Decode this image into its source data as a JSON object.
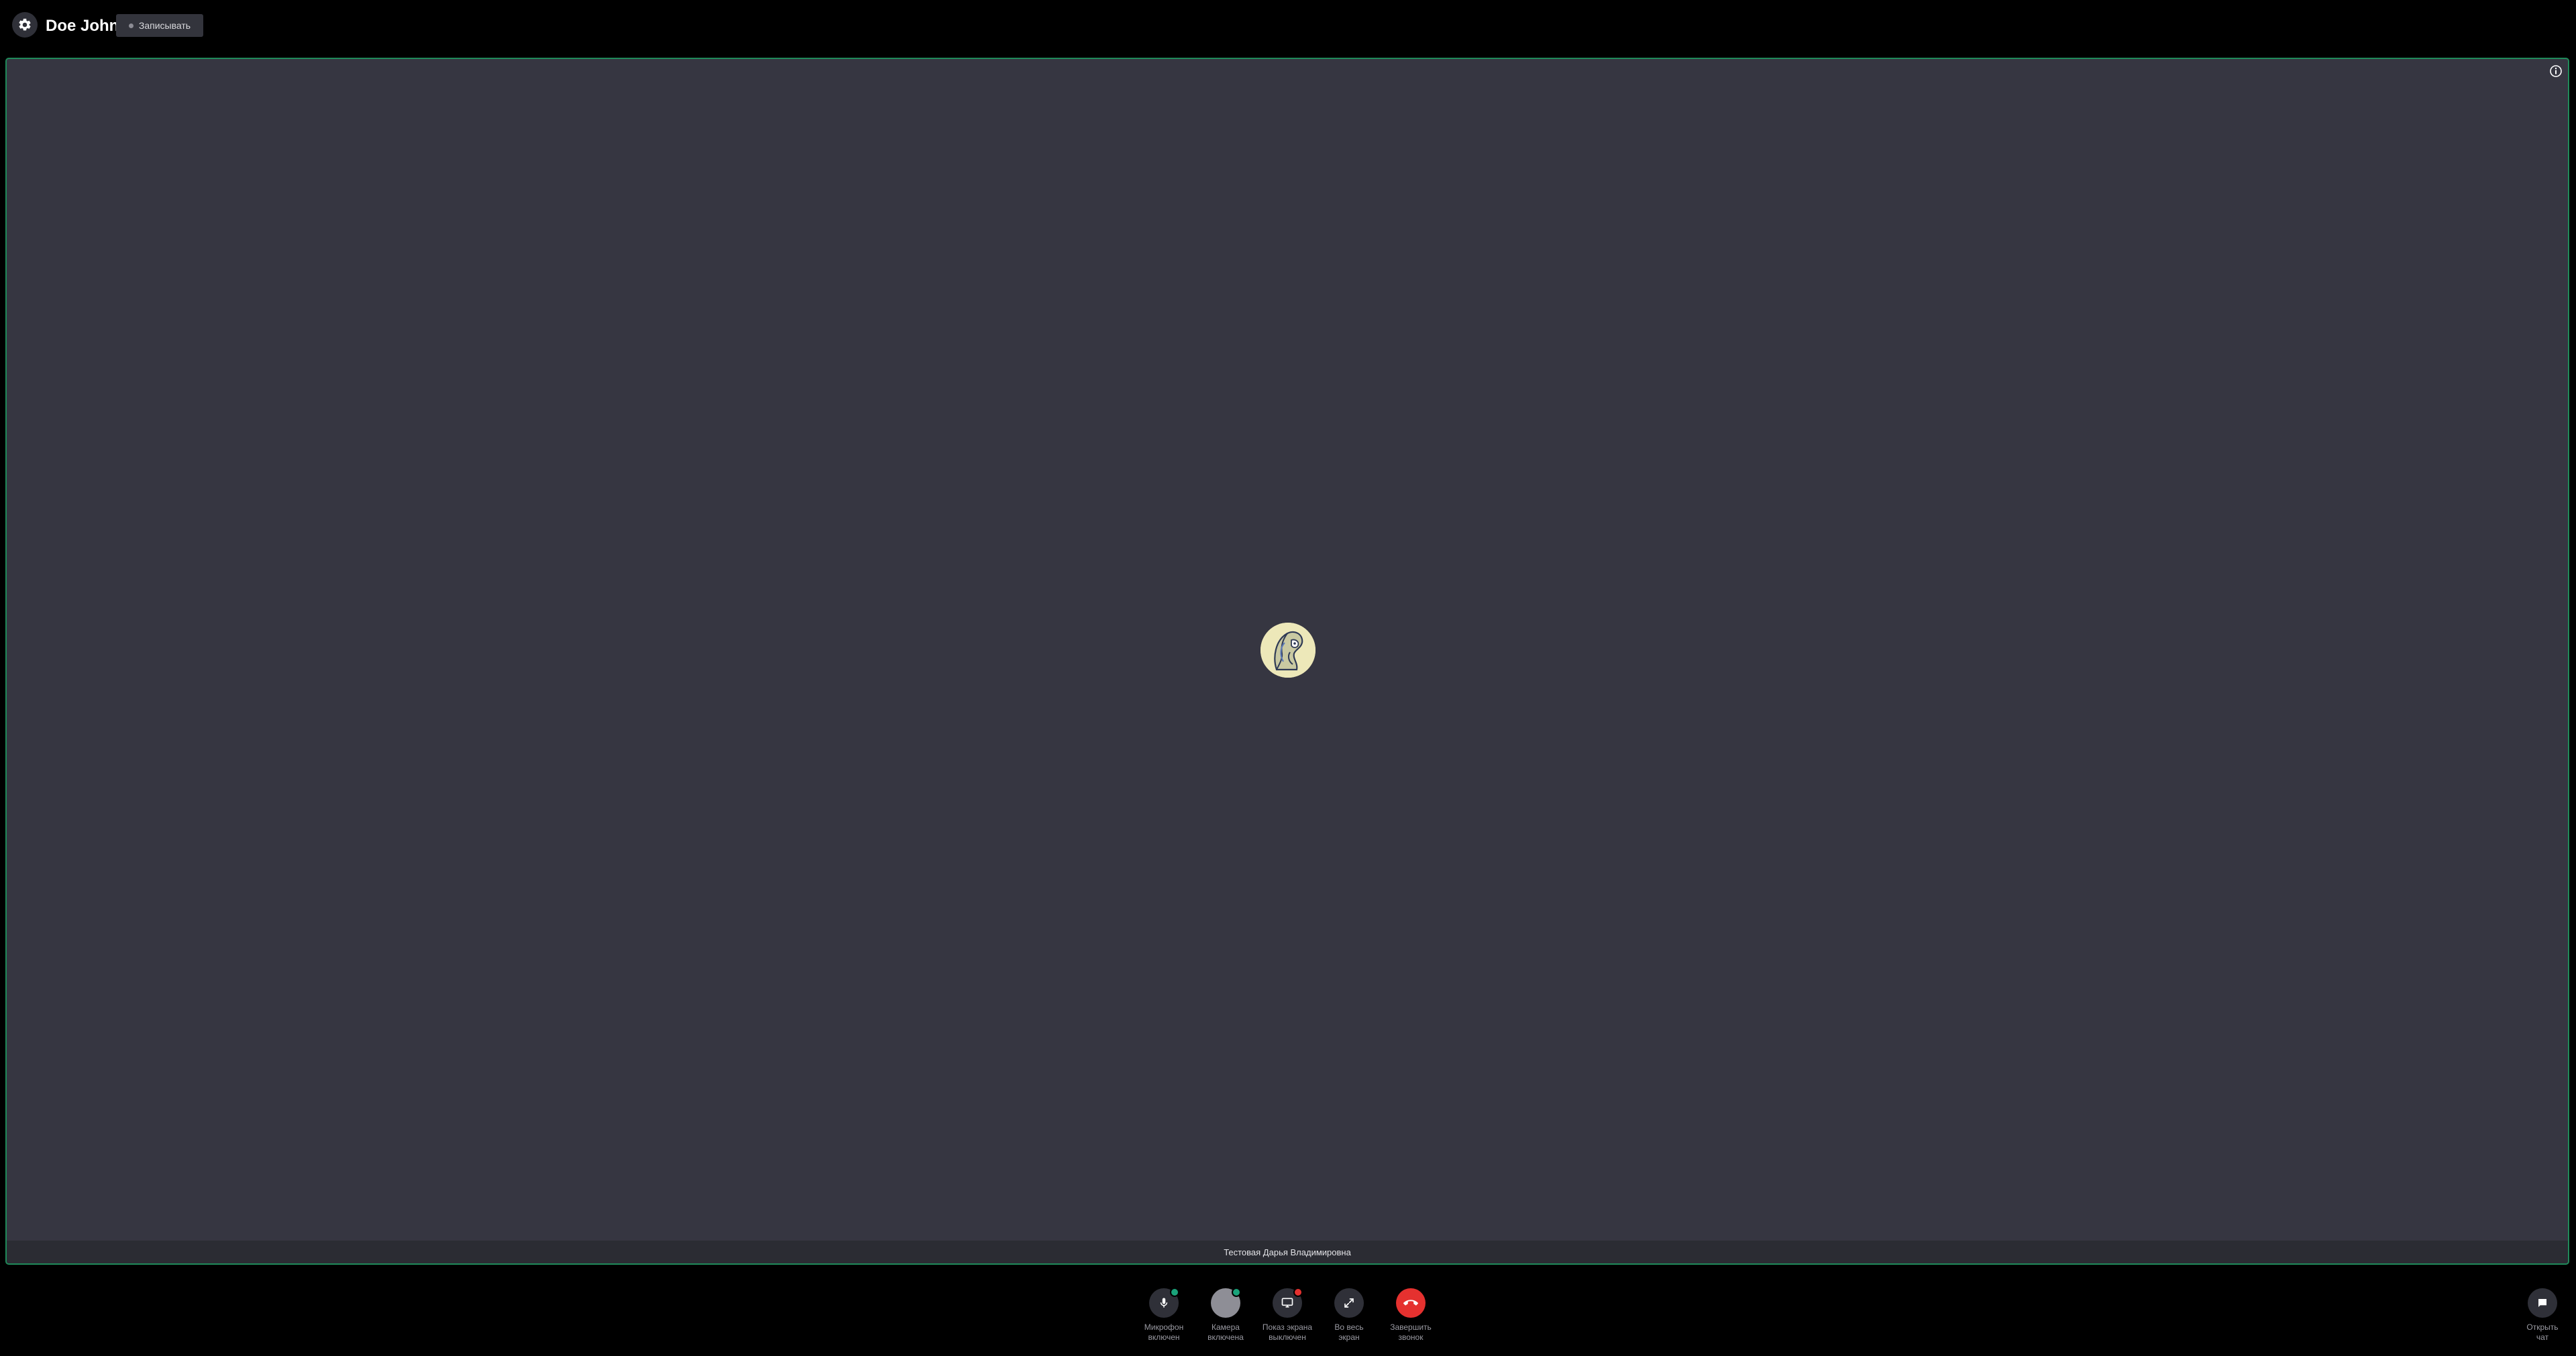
{
  "header": {
    "title": "Doe John",
    "record_label": "Записывать",
    "settings_icon": "gear-icon"
  },
  "stage": {
    "participant_name": "Тестовая Дарья Владимировна",
    "info_icon": "info-icon",
    "avatar_icon": "unicorn-avatar-icon",
    "active_border_color": "#1f8a5a",
    "background_color": "#363641"
  },
  "controls": {
    "microphone": {
      "line1": "Микрофон",
      "line2": "включен",
      "icon": "microphone-icon",
      "status_color": "#1aa37a"
    },
    "camera": {
      "line1": "Камера",
      "line2": "включена",
      "icon": "camera-icon",
      "status_color": "#1aa37a"
    },
    "screen_share": {
      "line1": "Показ экрана",
      "line2": "выключен",
      "icon": "screen-share-icon",
      "status_color": "#e5312f"
    },
    "fullscreen": {
      "line1": "Во весь",
      "line2": "экран",
      "icon": "expand-icon"
    },
    "hangup": {
      "line1": "Завершить",
      "line2": "звонок",
      "icon": "phone-hangup-icon",
      "color": "#e5312f"
    },
    "chat": {
      "line1": "Открыть",
      "line2": "чат",
      "icon": "chat-icon"
    }
  }
}
